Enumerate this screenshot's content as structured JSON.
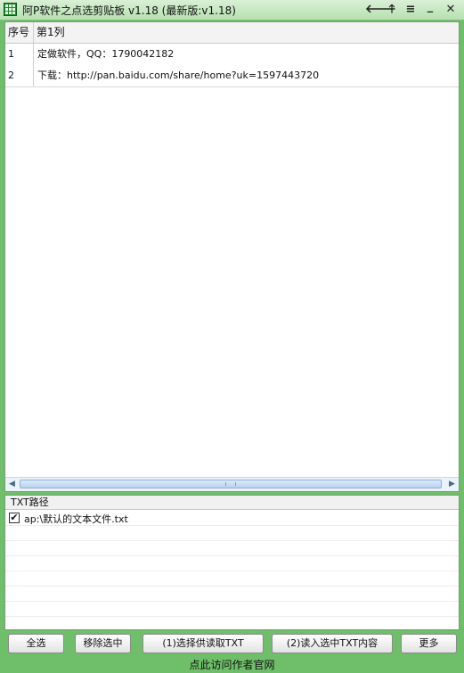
{
  "window": {
    "title": "阿P软件之点选剪贴板  v1.18 (最新版:v1.18)",
    "controls": {
      "back": "🡐",
      "up": "🡑",
      "menu": "≡",
      "minimize": "_",
      "close": "✕"
    }
  },
  "table": {
    "headers": [
      "序号",
      "第1列"
    ],
    "rows": [
      {
        "idx": "1",
        "text": "定做软件，QQ：1790042182"
      },
      {
        "idx": "2",
        "text": "下载：http://pan.baidu.com/share/home?uk=1597443720"
      }
    ]
  },
  "txt_panel": {
    "header": "TXT路径",
    "items": [
      {
        "checked": true,
        "check_mark": "✔",
        "path": "ap:\\默认的文本文件.txt"
      }
    ]
  },
  "buttons": {
    "select_all": "全选",
    "remove_selected": "移除选中",
    "choose_txt": "(1)选择供读取TXT",
    "read_txt": "(2)读入选中TXT内容",
    "more": "更多"
  },
  "status": {
    "link": "点此访问作者官网"
  },
  "colors": {
    "accent": "#6fbf6a",
    "title_bg": "#c7e8c2",
    "scroll": "#dbe9f8"
  }
}
